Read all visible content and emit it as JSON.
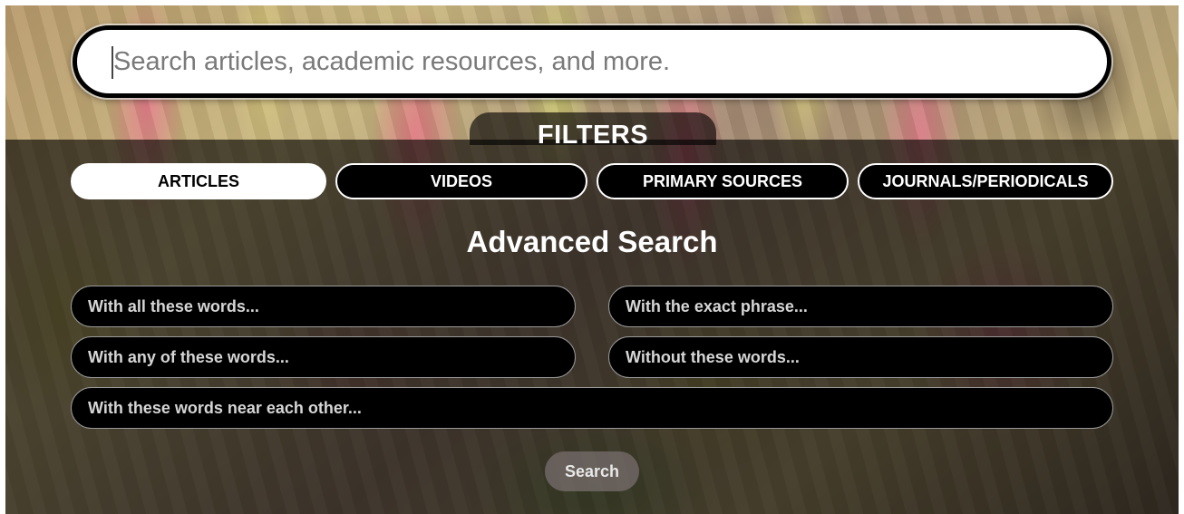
{
  "search": {
    "placeholder": "Search articles, academic resources, and more."
  },
  "filters": {
    "label": "FILTERS",
    "tabs": [
      {
        "label": "ARTICLES",
        "active": true
      },
      {
        "label": "VIDEOS",
        "active": false
      },
      {
        "label": "PRIMARY SOURCES",
        "active": false
      },
      {
        "label": "JOURNALS/PERIODICALS",
        "active": false
      }
    ]
  },
  "advanced": {
    "title": "Advanced Search",
    "fields": {
      "all_words": "With all these words...",
      "exact_phrase": "With the exact phrase...",
      "any_words": "With any of these words...",
      "without_words": "Without these words...",
      "near_words": "With these words near each other..."
    },
    "search_label": "Search"
  },
  "colors": {
    "tab_active_bg": "#ffffff",
    "tab_inactive_bg": "#000000",
    "overlay": "rgba(0,0,0,0.62)"
  }
}
